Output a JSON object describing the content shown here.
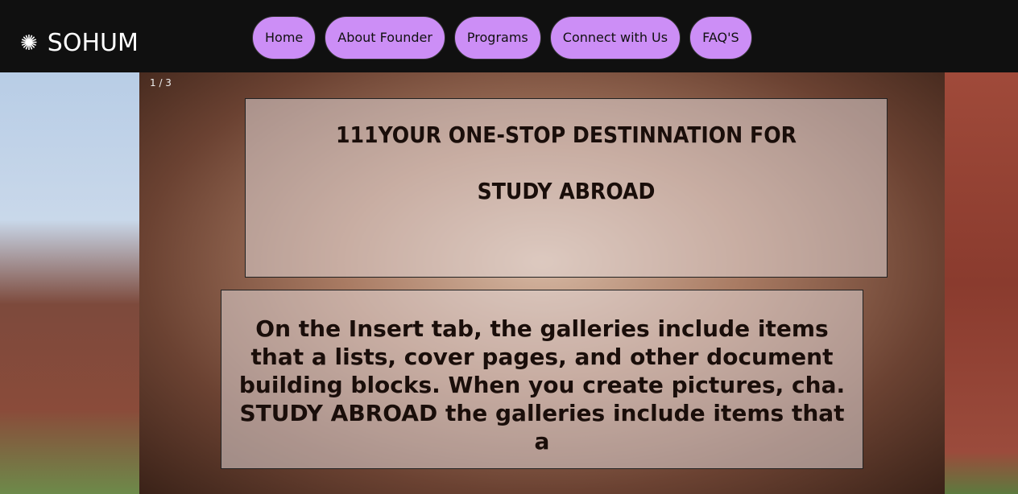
{
  "brand": {
    "name": "SOHUM",
    "icon": "sunburst-icon"
  },
  "nav": {
    "items": [
      "Home",
      "About Founder",
      "Programs",
      "Connect with Us",
      "FAQ'S"
    ],
    "color": "#cc8ef6"
  },
  "slider": {
    "counter": "1 / 3"
  },
  "hero": {
    "title_line1": "111YOUR ONE-STOP DESTINNATION FOR",
    "title_line2": "STUDY ABROAD",
    "body": "On the Insert tab, the galleries include items that a lists, cover pages, and other document building blocks. When you create pictures, cha. STUDY ABROAD the galleries include items that a"
  }
}
